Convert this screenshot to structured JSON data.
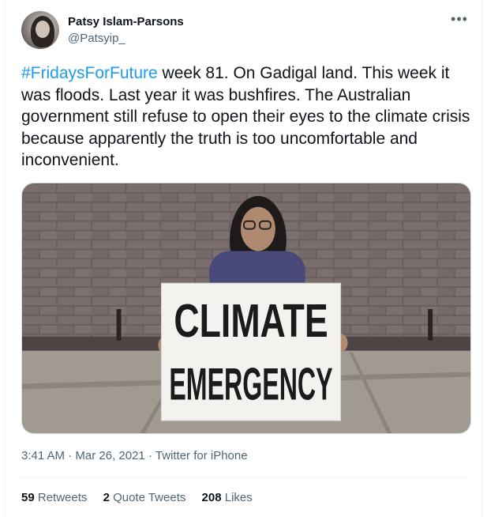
{
  "author": {
    "display_name": "Patsy Islam-Parsons",
    "handle": "@Patsyip_"
  },
  "tweet": {
    "hashtag": "#FridaysForFuture",
    "text": " week 81. On Gadigal land. This week it was floods. Last year it was bushfires. The Australian government still refuse to open their eyes to the climate crisis because apparently the truth is too uncomfortable and inconvenient.",
    "sign_line1": "CLIMATE",
    "sign_line2": "EMERGENCY"
  },
  "meta": {
    "time": "3:41 AM",
    "date": "Mar 26, 2021",
    "source": "Twitter for iPhone",
    "separator": "·"
  },
  "stats": {
    "retweets_count": "59",
    "retweets_label": "Retweets",
    "quotes_count": "2",
    "quotes_label": "Quote Tweets",
    "likes_count": "208",
    "likes_label": "Likes"
  },
  "icons": {
    "more": "more-options-icon"
  },
  "colors": {
    "link": "#1d9bf0",
    "secondary_text": "#536471",
    "primary_text": "#0f1419"
  }
}
